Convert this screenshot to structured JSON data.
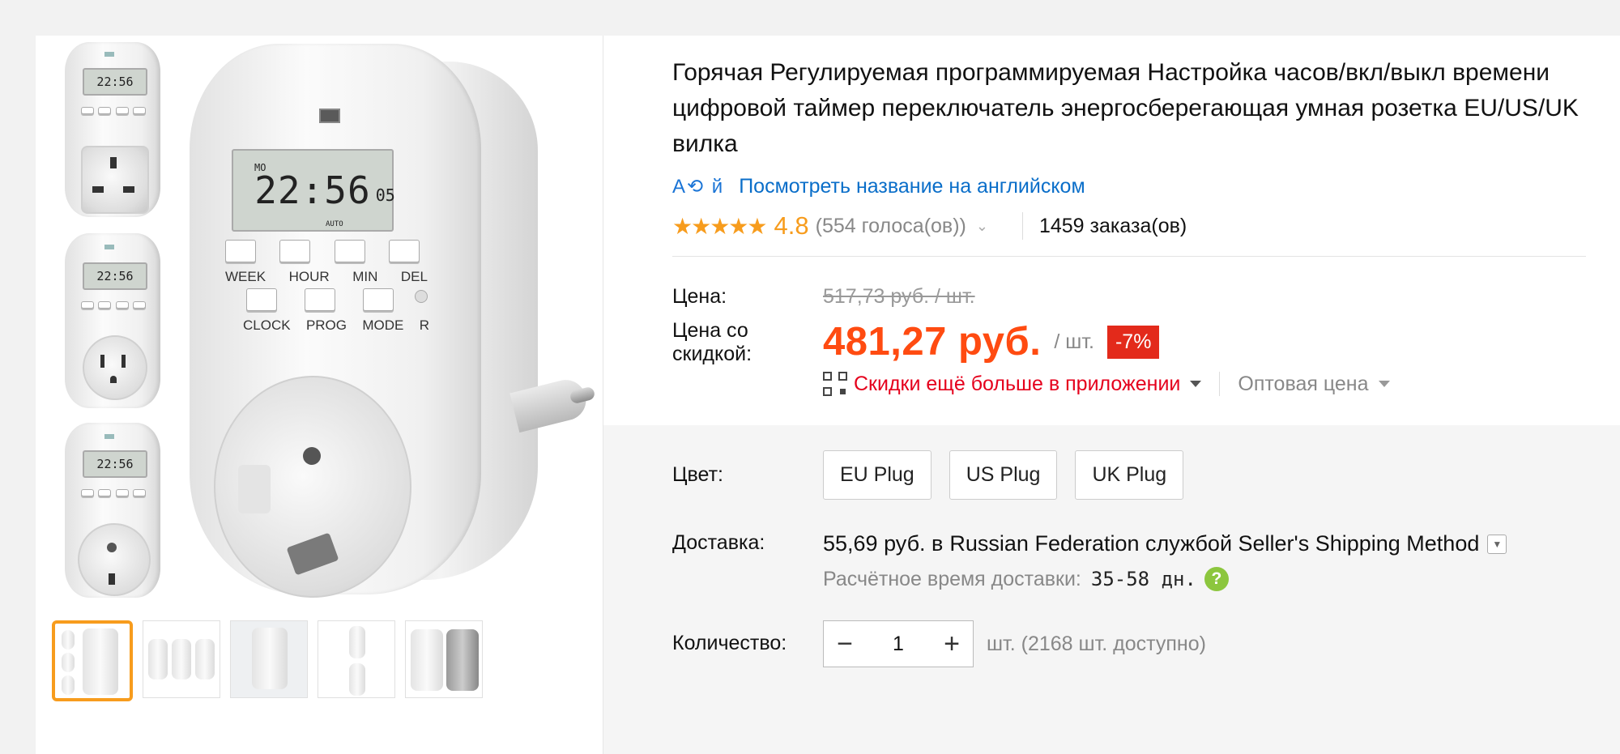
{
  "product": {
    "title": "Горячая Регулируемая программируемая Настройка часов/вкл/выкл времени цифровой таймер переключатель энергосберегающая умная розетка EU/US/UK вилка",
    "translate_icon": "А⟲ й",
    "translate_link": "Посмотреть название на английском",
    "stars": "★★★★★",
    "rating": "4.8",
    "votes": "(554 голоса(ов))",
    "orders": "1459 заказа(ов)"
  },
  "device": {
    "lcd_day": "MO",
    "lcd_time": "22:56",
    "lcd_sec": "05",
    "lcd_mode": "AUTO",
    "keys_row1": [
      "WEEK",
      "HOUR",
      "MIN",
      "DEL"
    ],
    "keys_row2": [
      "CLOCK",
      "PROG",
      "MODE",
      "R"
    ]
  },
  "price": {
    "label": "Цена:",
    "original": "517,73 руб. / шт.",
    "discount_label": "Цена со скидкой:",
    "current": "481,27 руб.",
    "unit": "/ шт.",
    "discount_badge": "-7%",
    "app_promo": "Скидки ещё больше в приложении",
    "wholesale": "Оптовая цена"
  },
  "color": {
    "label": "Цвет:",
    "options": [
      "EU Plug",
      "US Plug",
      "UK Plug"
    ]
  },
  "shipping": {
    "label": "Доставка:",
    "cost": "55,69 руб. в",
    "service": "Russian Federation службой Seller's Shipping Method",
    "eta_label": "Расчётное время доставки:",
    "eta_value": "35-58 дн.",
    "help": "?"
  },
  "quantity": {
    "label": "Количество:",
    "minus": "−",
    "value": "1",
    "plus": "+",
    "available": "шт. (2168 шт. доступно)"
  },
  "colors": {
    "accent_orange": "#f79c1d",
    "price_red": "#ff4b11",
    "badge_red": "#e32a1b",
    "link_blue": "#0a6ec9",
    "promo_red": "#e5001c"
  }
}
